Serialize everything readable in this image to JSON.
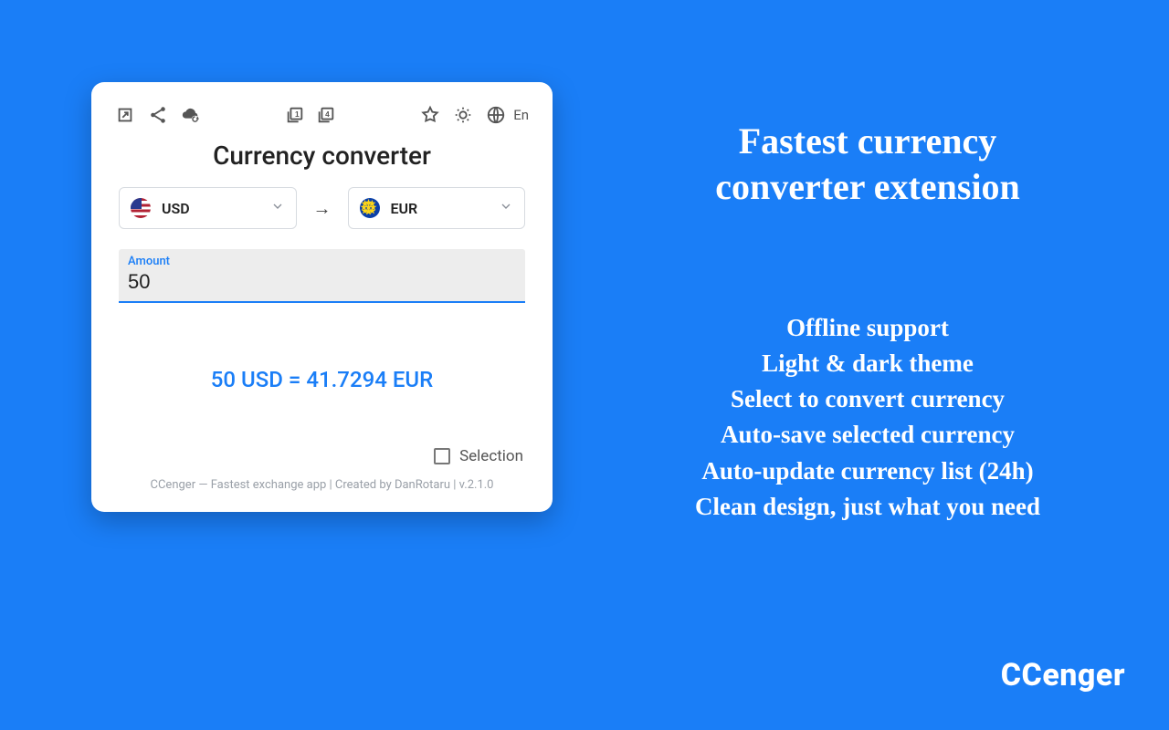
{
  "card": {
    "title": "Currency converter",
    "from": {
      "code": "USD"
    },
    "to": {
      "code": "EUR"
    },
    "amount_label": "Amount",
    "amount_value": "50",
    "result_text": "50 USD = 41.7294 EUR",
    "selection_label": "Selection",
    "footer_text": "CCenger — Fastest exchange app | Created by DanRotaru | v.2.1.0",
    "lang": "En"
  },
  "promo": {
    "headline_line1": "Fastest currency",
    "headline_line2": "converter extension",
    "features": [
      "Offline support",
      "Light & dark theme",
      "Select to convert currency",
      "Auto-save selected currency",
      "Auto-update currency list (24h)",
      "Clean design, just what you need"
    ],
    "brand": "CCenger"
  }
}
